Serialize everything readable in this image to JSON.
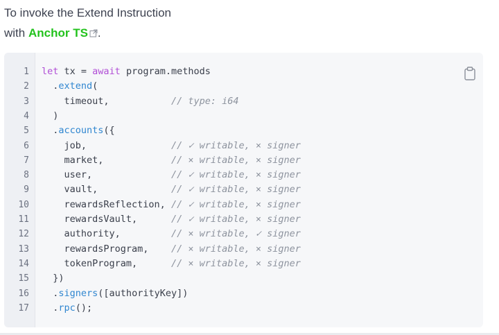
{
  "intro": {
    "line1": "To invoke the Extend Instruction",
    "line2_prefix": "with ",
    "link_text": "Anchor TS",
    "line2_suffix": "."
  },
  "code": {
    "lines": [
      {
        "n": "1",
        "parts": [
          {
            "t": "let ",
            "c": "kw"
          },
          {
            "t": "tx = ",
            "c": ""
          },
          {
            "t": "await ",
            "c": "kw"
          },
          {
            "t": "program.methods",
            "c": ""
          }
        ]
      },
      {
        "n": "2",
        "parts": [
          {
            "t": "  .",
            "c": ""
          },
          {
            "t": "extend",
            "c": "meth"
          },
          {
            "t": "(",
            "c": ""
          }
        ]
      },
      {
        "n": "3",
        "parts": [
          {
            "t": "    timeout,           ",
            "c": ""
          },
          {
            "t": "// type: i64",
            "c": "cmt"
          }
        ]
      },
      {
        "n": "4",
        "parts": [
          {
            "t": "  )",
            "c": ""
          }
        ]
      },
      {
        "n": "5",
        "parts": [
          {
            "t": "  .",
            "c": ""
          },
          {
            "t": "accounts",
            "c": "meth"
          },
          {
            "t": "({",
            "c": ""
          }
        ]
      },
      {
        "n": "6",
        "parts": [
          {
            "t": "    job,               ",
            "c": ""
          },
          {
            "t": "// ✓ writable, × signer",
            "c": "cmt"
          }
        ]
      },
      {
        "n": "7",
        "parts": [
          {
            "t": "    market,            ",
            "c": ""
          },
          {
            "t": "// × writable, × signer",
            "c": "cmt"
          }
        ]
      },
      {
        "n": "8",
        "parts": [
          {
            "t": "    user,              ",
            "c": ""
          },
          {
            "t": "// ✓ writable, × signer",
            "c": "cmt"
          }
        ]
      },
      {
        "n": "9",
        "parts": [
          {
            "t": "    vault,             ",
            "c": ""
          },
          {
            "t": "// ✓ writable, × signer",
            "c": "cmt"
          }
        ]
      },
      {
        "n": "10",
        "parts": [
          {
            "t": "    rewardsReflection, ",
            "c": ""
          },
          {
            "t": "// ✓ writable, × signer",
            "c": "cmt"
          }
        ]
      },
      {
        "n": "11",
        "parts": [
          {
            "t": "    rewardsVault,      ",
            "c": ""
          },
          {
            "t": "// ✓ writable, × signer",
            "c": "cmt"
          }
        ]
      },
      {
        "n": "12",
        "parts": [
          {
            "t": "    authority,         ",
            "c": ""
          },
          {
            "t": "// × writable, ✓ signer",
            "c": "cmt"
          }
        ]
      },
      {
        "n": "13",
        "parts": [
          {
            "t": "    rewardsProgram,    ",
            "c": ""
          },
          {
            "t": "// × writable, × signer",
            "c": "cmt"
          }
        ]
      },
      {
        "n": "14",
        "parts": [
          {
            "t": "    tokenProgram,      ",
            "c": ""
          },
          {
            "t": "// × writable, × signer",
            "c": "cmt"
          }
        ]
      },
      {
        "n": "15",
        "parts": [
          {
            "t": "  })",
            "c": ""
          }
        ]
      },
      {
        "n": "16",
        "parts": [
          {
            "t": "  .",
            "c": ""
          },
          {
            "t": "signers",
            "c": "meth"
          },
          {
            "t": "([authorityKey])",
            "c": ""
          }
        ]
      },
      {
        "n": "17",
        "parts": [
          {
            "t": "  .",
            "c": ""
          },
          {
            "t": "rpc",
            "c": "meth"
          },
          {
            "t": "();",
            "c": ""
          }
        ]
      }
    ]
  },
  "icons": {
    "copy": "clipboard-icon",
    "external": "external-link-icon"
  },
  "colors": {
    "link": "#22c21c",
    "keyword": "#b14fd6",
    "method": "#2f86d0",
    "comment": "#8d939e",
    "code_bg": "#f6f7f9"
  }
}
